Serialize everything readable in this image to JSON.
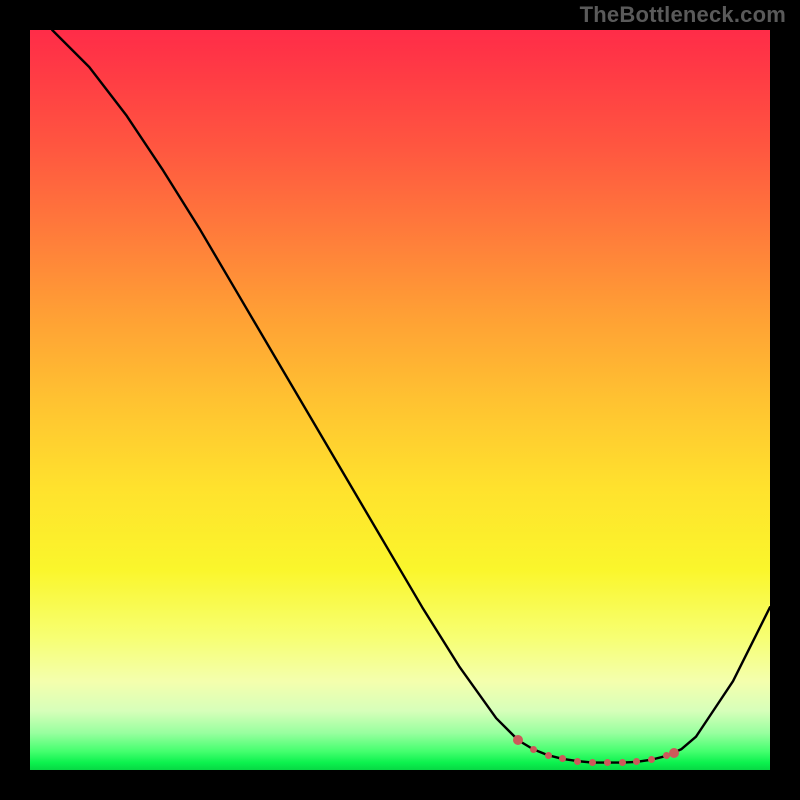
{
  "watermark": "TheBottleneck.com",
  "colors": {
    "curve_stroke": "#000000",
    "marker_fill": "#cc5a5a",
    "frame_bg": "#000000"
  },
  "chart_data": {
    "type": "line",
    "title": "",
    "xlabel": "",
    "ylabel": "",
    "xlim": [
      0,
      100
    ],
    "ylim": [
      0,
      100
    ],
    "x": [
      3,
      8,
      13,
      18,
      23,
      28,
      33,
      38,
      43,
      48,
      53,
      58,
      63,
      66,
      68,
      70,
      72,
      74,
      76,
      78,
      80,
      82,
      84,
      86,
      88,
      90,
      92,
      95,
      98,
      100
    ],
    "y": [
      100,
      95,
      88.5,
      81,
      73,
      64.5,
      56,
      47.5,
      39,
      30.5,
      22,
      14,
      7,
      4,
      2.8,
      2.0,
      1.5,
      1.2,
      1.0,
      1.0,
      1.0,
      1.1,
      1.4,
      1.9,
      2.8,
      4.5,
      7.5,
      12,
      18,
      22
    ],
    "markers_x": [
      66,
      68,
      70,
      72,
      74,
      76,
      78,
      80,
      82,
      84,
      86,
      87
    ],
    "markers_y": [
      4.0,
      2.8,
      2.0,
      1.5,
      1.2,
      1.0,
      1.0,
      1.0,
      1.1,
      1.4,
      1.9,
      2.3
    ]
  }
}
